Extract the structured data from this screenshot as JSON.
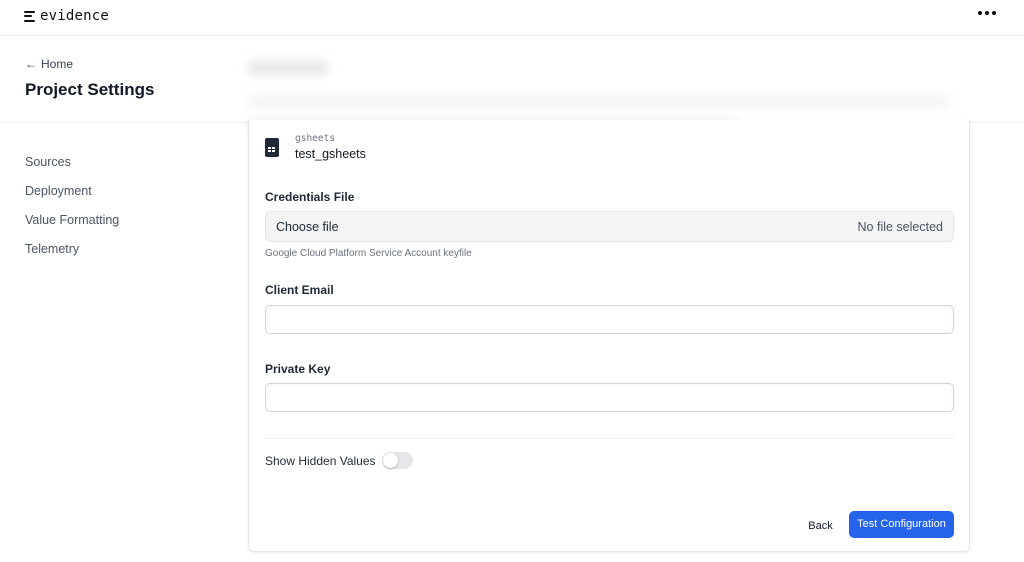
{
  "app": {
    "logo_text": "evidence",
    "menu_icon": "more-horizontal-icon"
  },
  "header": {
    "back_label": "Home",
    "back_icon": "arrow-left-icon",
    "title": "Project Settings"
  },
  "sidebar": {
    "items": [
      {
        "label": "Sources"
      },
      {
        "label": "Deployment"
      },
      {
        "label": "Value Formatting"
      },
      {
        "label": "Telemetry"
      }
    ]
  },
  "source": {
    "type": "gsheets",
    "name": "test_gsheets",
    "icon": "spreadsheet-icon"
  },
  "form": {
    "credentials_label": "Credentials File",
    "file_choose": "Choose file",
    "file_status": "No file selected",
    "credentials_hint": "Google Cloud Platform Service Account keyfile",
    "client_email_label": "Client Email",
    "client_email_value": "",
    "private_key_label": "Private Key",
    "private_key_value": "",
    "show_hidden_label": "Show Hidden Values",
    "show_hidden_on": false
  },
  "actions": {
    "back_label": "Back",
    "test_label": "Test Configuration"
  },
  "colors": {
    "primary": "#2563eb"
  }
}
